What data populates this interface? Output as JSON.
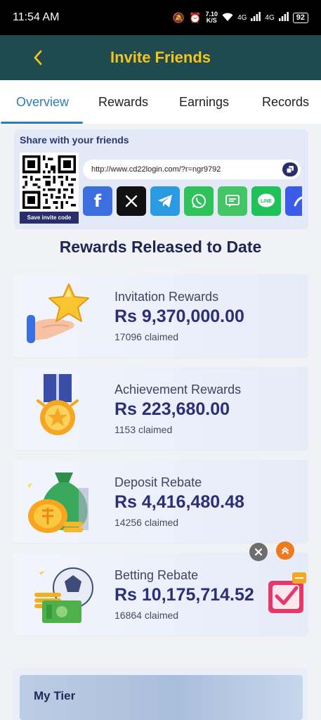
{
  "status_bar": {
    "time": "11:54 AM",
    "speed_value": "7.10",
    "speed_unit": "K/S",
    "network_1": "4G",
    "network_2": "4G",
    "battery": "92"
  },
  "header": {
    "title": "Invite Friends",
    "back_icon": "chevron-left-icon"
  },
  "tabs": [
    {
      "label": "Overview",
      "active": true
    },
    {
      "label": "Rewards",
      "active": false
    },
    {
      "label": "Earnings",
      "active": false
    },
    {
      "label": "Records",
      "active": false
    }
  ],
  "share": {
    "title": "Share with your friends",
    "save_label": "Save invite code",
    "link": "http://www.cd22login.com/?r=ngr9792",
    "socials": [
      {
        "name": "facebook",
        "icon": "facebook-icon",
        "color": "#3b6fe0"
      },
      {
        "name": "x",
        "icon": "x-icon",
        "color": "#111111"
      },
      {
        "name": "telegram",
        "icon": "telegram-icon",
        "color": "#2a9be0"
      },
      {
        "name": "whatsapp",
        "icon": "whatsapp-icon",
        "color": "#2fc15a"
      },
      {
        "name": "sms",
        "icon": "message-icon",
        "color": "#43c465"
      },
      {
        "name": "line",
        "icon": "line-icon",
        "label": "LINE",
        "color": "#1fc258"
      },
      {
        "name": "more",
        "icon": "share-more-icon",
        "color": "#3a5ce8"
      }
    ]
  },
  "rewards": {
    "title": "Rewards Released to Date",
    "items": [
      {
        "label": "Invitation Rewards",
        "amount": "Rs  9,370,000.00",
        "claimed": "17096 claimed",
        "icon": "hand-star-icon"
      },
      {
        "label": "Achievement Rewards",
        "amount": "Rs  223,680.00",
        "claimed": "1153 claimed",
        "icon": "medal-icon"
      },
      {
        "label": "Deposit Rebate",
        "amount": "Rs  4,416,480.48",
        "claimed": "14256 claimed",
        "icon": "money-bag-icon"
      },
      {
        "label": "Betting Rebate",
        "amount": "Rs  10,175,714.52",
        "claimed": "16864 claimed",
        "icon": "football-cash-icon"
      }
    ]
  },
  "floating": {
    "close_icon": "close-icon",
    "up_icon": "double-chevron-up-icon",
    "gift_icon": "gift-calendar-icon"
  },
  "tier": {
    "title": "My Tier"
  },
  "colors": {
    "header_bg": "#1f4b4f",
    "header_title": "#f3c420",
    "tab_active": "#2a7fb8",
    "amount": "#2c2f78"
  }
}
